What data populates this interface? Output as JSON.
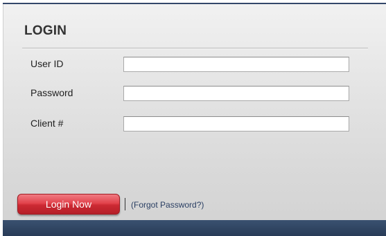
{
  "login": {
    "title": "LOGIN",
    "fields": [
      {
        "label": "User ID",
        "value": "",
        "placeholder": ""
      },
      {
        "label": "Password",
        "value": "",
        "placeholder": ""
      },
      {
        "label": "Client #",
        "value": "",
        "placeholder": ""
      }
    ],
    "submit_label": "Login Now",
    "separator": "|",
    "forgot_label": "(Forgot Password?)"
  },
  "colors": {
    "button_red": "#d33841",
    "link_blue": "#2a3f63",
    "footer_navy": "#2f4463"
  }
}
